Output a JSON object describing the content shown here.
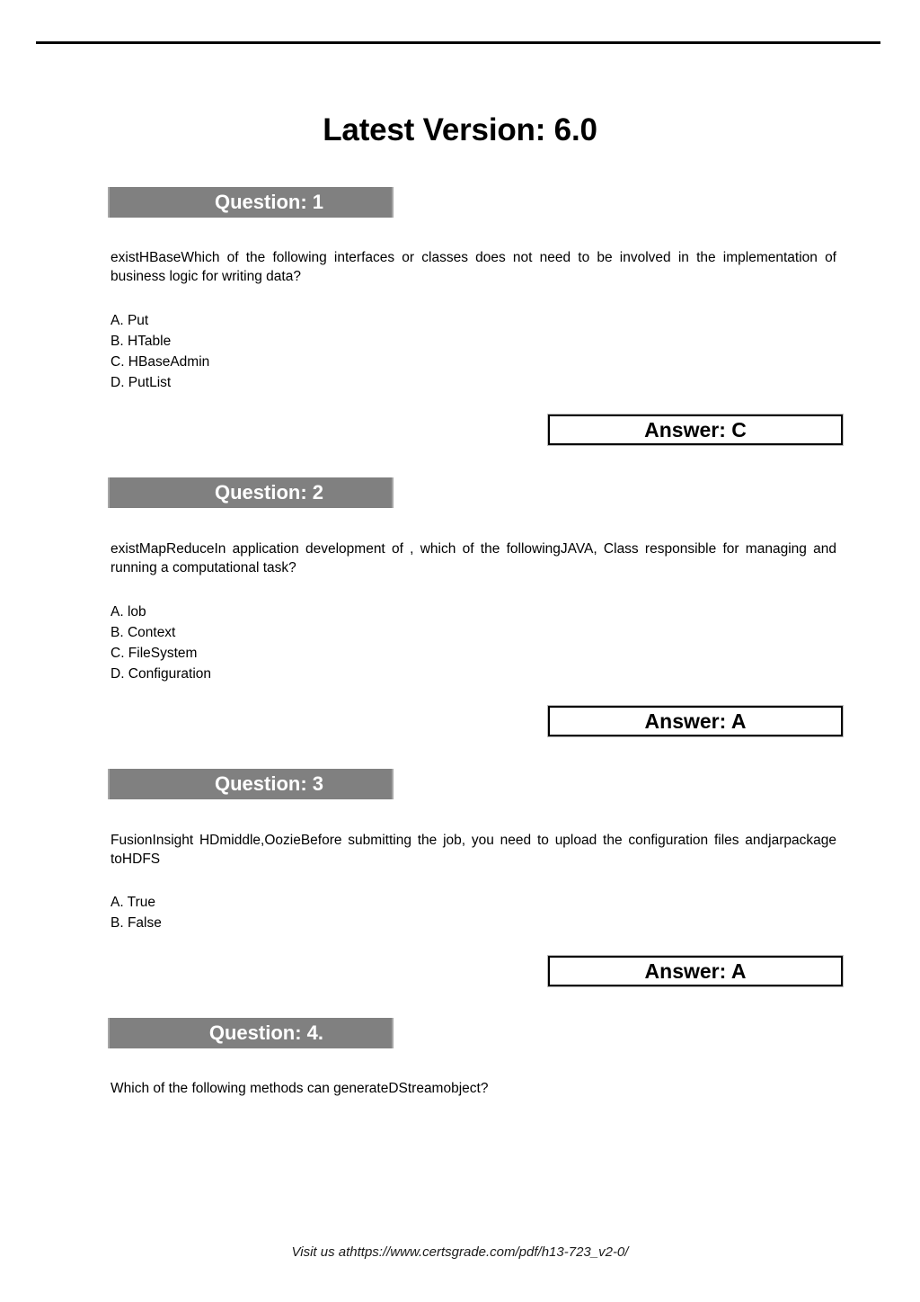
{
  "document": {
    "title": "Latest Version: 6.0",
    "footer": "Visit us athttps://www.certsgrade.com/pdf/h13-723_v2-0/",
    "colors": {
      "banner_background": "#808080",
      "banner_text": "#ffffff",
      "answer_border": "#000000",
      "page_background": "#ffffff",
      "text": "#000000"
    }
  },
  "questions": [
    {
      "banner": "Question: 1",
      "body": "existHBaseWhich of the following interfaces or classes does not need to be involved in the implementation of business logic for writing data?",
      "options": [
        "A. Put",
        "B. HTable",
        "C. HBaseAdmin",
        "D. PutList"
      ],
      "answer": "Answer: C"
    },
    {
      "banner": "Question: 2",
      "body": "existMapReduceIn application development of , which of the followingJAVA, Class responsible for managing and running a computational task?",
      "options": [
        "A. lob",
        "B. Context",
        "C. FileSystem",
        "D. Configuration"
      ],
      "answer": "Answer: A"
    },
    {
      "banner": "Question: 3",
      "body": "FusionInsight HDmiddle,OozieBefore submitting the job, you need to upload the configuration files andjarpackage toHDFS",
      "options": [
        "A. True",
        "B. False"
      ],
      "answer": "Answer: A"
    },
    {
      "banner": "Question: 4.",
      "body": "Which of the following methods can generateDStreamobject?",
      "options": [],
      "answer": null
    }
  ]
}
